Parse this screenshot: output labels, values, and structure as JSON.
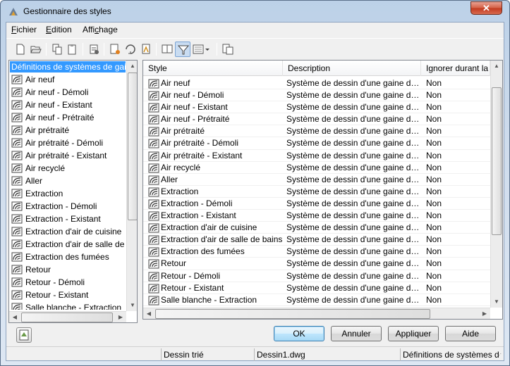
{
  "window": {
    "title": "Gestionnaire des styles",
    "close_glyph": "✕"
  },
  "menu": [
    {
      "label": "Fichier",
      "u": "F",
      "rest": "ichier"
    },
    {
      "label": "Edition",
      "u": "E",
      "rest": "dition"
    },
    {
      "label": "Affichage",
      "pre": "Affi",
      "u": "c",
      "rest": "hage"
    }
  ],
  "toolbar": {
    "buttons": [
      "new-icon",
      "open-icon",
      "copy-icon",
      "paste-icon",
      "purge-icon",
      "edit-style-icon",
      "set-from-icon",
      "import-icon",
      "compare-icon",
      "filter-icon",
      "view-options-icon",
      "toggle-view-icon"
    ],
    "active": "filter-icon"
  },
  "tree": {
    "header": "Définitions de systèmes de gaine",
    "items": [
      "Air neuf",
      "Air neuf - Démoli",
      "Air neuf - Existant",
      "Air neuf - Prétraité",
      "Air prétraité",
      "Air prétraité - Démoli",
      "Air prétraité - Existant",
      "Air recyclé",
      "Aller",
      "Extraction",
      "Extraction - Démoli",
      "Extraction - Existant",
      "Extraction d'air de cuisine",
      "Extraction d'air de salle de bains",
      "Extraction des fumées",
      "Retour",
      "Retour - Démoli",
      "Retour - Existant",
      "Salle blanche - Extraction"
    ]
  },
  "list": {
    "columns": [
      "Style",
      "Description",
      "Ignorer durant la synchronisation"
    ],
    "rows": [
      [
        "Air neuf",
        "Système de dessin d'une gaine d'air neuf",
        "Non"
      ],
      [
        "Air neuf - Démoli",
        "Système de dessin d'une gaine d'air neuf",
        "Non"
      ],
      [
        "Air neuf - Existant",
        "Système de dessin d'une gaine d'air neuf",
        "Non"
      ],
      [
        "Air neuf - Prétraité",
        "Système de dessin d'une gaine d'air neuf",
        "Non"
      ],
      [
        "Air prétraité",
        "Système de dessin d'une gaine d'air prétraité",
        "Non"
      ],
      [
        "Air prétraité - Démoli",
        "Système de dessin d'une gaine d'air prétraité",
        "Non"
      ],
      [
        "Air prétraité - Existant",
        "Système de dessin d'une gaine d'air prétraité",
        "Non"
      ],
      [
        "Air recyclé",
        "Système de dessin d'une gaine d'air recyclé",
        "Non"
      ],
      [
        "Aller",
        "Système de dessin d'une gaine de soufflage",
        "Non"
      ],
      [
        "Extraction",
        "Système de dessin d'une gaine d'extraction",
        "Non"
      ],
      [
        "Extraction - Démoli",
        "Système de dessin d'une gaine d'extraction",
        "Non"
      ],
      [
        "Extraction - Existant",
        "Système de dessin d'une gaine d'évacuation",
        "Non"
      ],
      [
        "Extraction d'air de cuisine",
        "Système de dessin d'une gaine d'extraction",
        "Non"
      ],
      [
        "Extraction d'air de salle de bains",
        "Système de dessin d'une gaine d'extraction",
        "Non"
      ],
      [
        "Extraction des fumées",
        "Système de dessin d'une gaine d'extraction",
        "Non"
      ],
      [
        "Retour",
        "Système de dessin d'une gaine de reprise",
        "Non"
      ],
      [
        "Retour - Démoli",
        "Système de dessin d'une gaine de reprise",
        "Non"
      ],
      [
        "Retour - Existant",
        "Système de dessin d'une gaine de reprise",
        "Non"
      ],
      [
        "Salle blanche - Extraction",
        "Système de dessin d'une gaine d'extraction",
        "Non"
      ]
    ]
  },
  "buttons": {
    "ok": "OK",
    "cancel": "Annuler",
    "apply": "Appliquer",
    "help": "Aide"
  },
  "status": {
    "sort": "Dessin trié",
    "file": "Dessin1.dwg",
    "category": "Définitions de systèmes de gaine"
  }
}
